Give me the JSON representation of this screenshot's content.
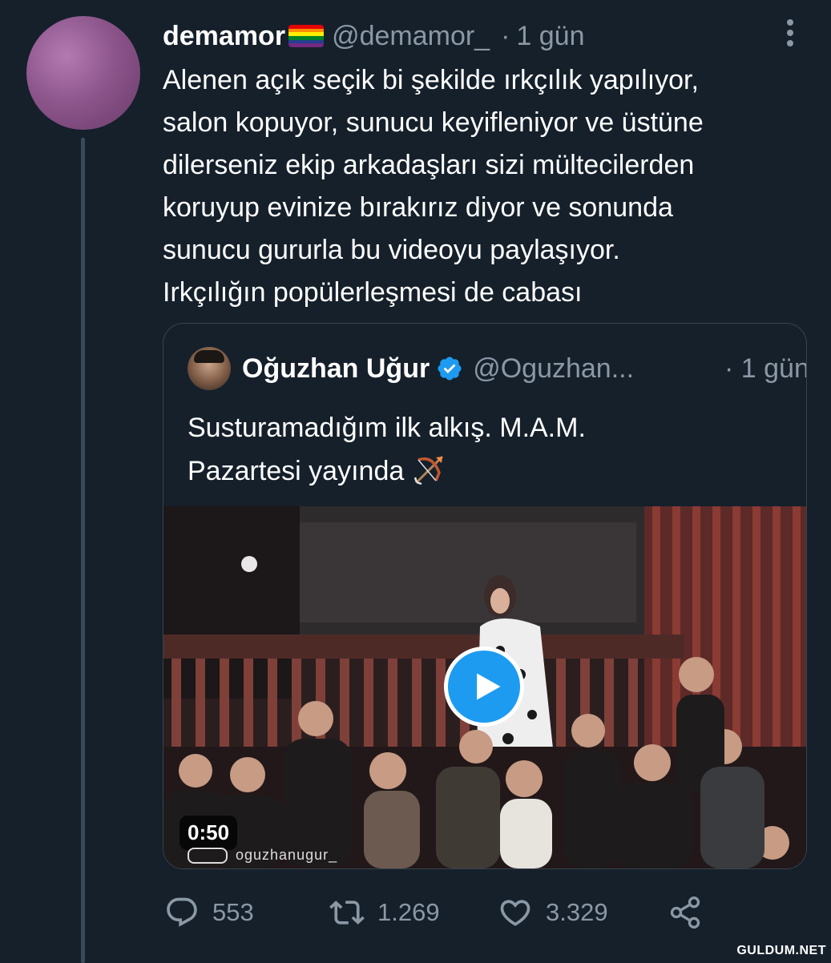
{
  "tweet": {
    "display_name": "demamor",
    "handle": "@demamor_",
    "separator": "·",
    "time": "1 gün",
    "text_lines": [
      "Alenen açık seçik bi şekilde ırkçılık yapılıyor,",
      "salon kopuyor, sunucu keyifleniyor ve üstüne",
      "dilerseniz ekip arkadaşları sizi mültecilerden",
      "koruyup evinize bırakırız diyor ve sonunda",
      "sunucu gururla bu videoyu paylaşıyor.",
      "Irkçılığın popülerleşmesi de cabası"
    ]
  },
  "quote": {
    "display_name": "Oğuzhan Uğur",
    "handle": "@Oguzhan...",
    "time": "· 1 gün",
    "text_lines": [
      "Susturamadığım ilk alkış. M.A.M.",
      "Pazartesi yayında"
    ],
    "video": {
      "duration": "0:50",
      "watermark": "oguzhanugur_"
    }
  },
  "actions": {
    "replies": "553",
    "retweets": "1.269",
    "likes": "3.329"
  },
  "site_watermark": "GULDUM.NET",
  "colors": {
    "background": "#15202b",
    "muted": "#8b98a5",
    "accent": "#1d9bf0",
    "border": "#38444d"
  },
  "icons": [
    "more-icon",
    "verified-icon",
    "bow-and-arrow-icon",
    "play-icon",
    "reply-icon",
    "retweet-icon",
    "like-icon",
    "share-icon"
  ]
}
